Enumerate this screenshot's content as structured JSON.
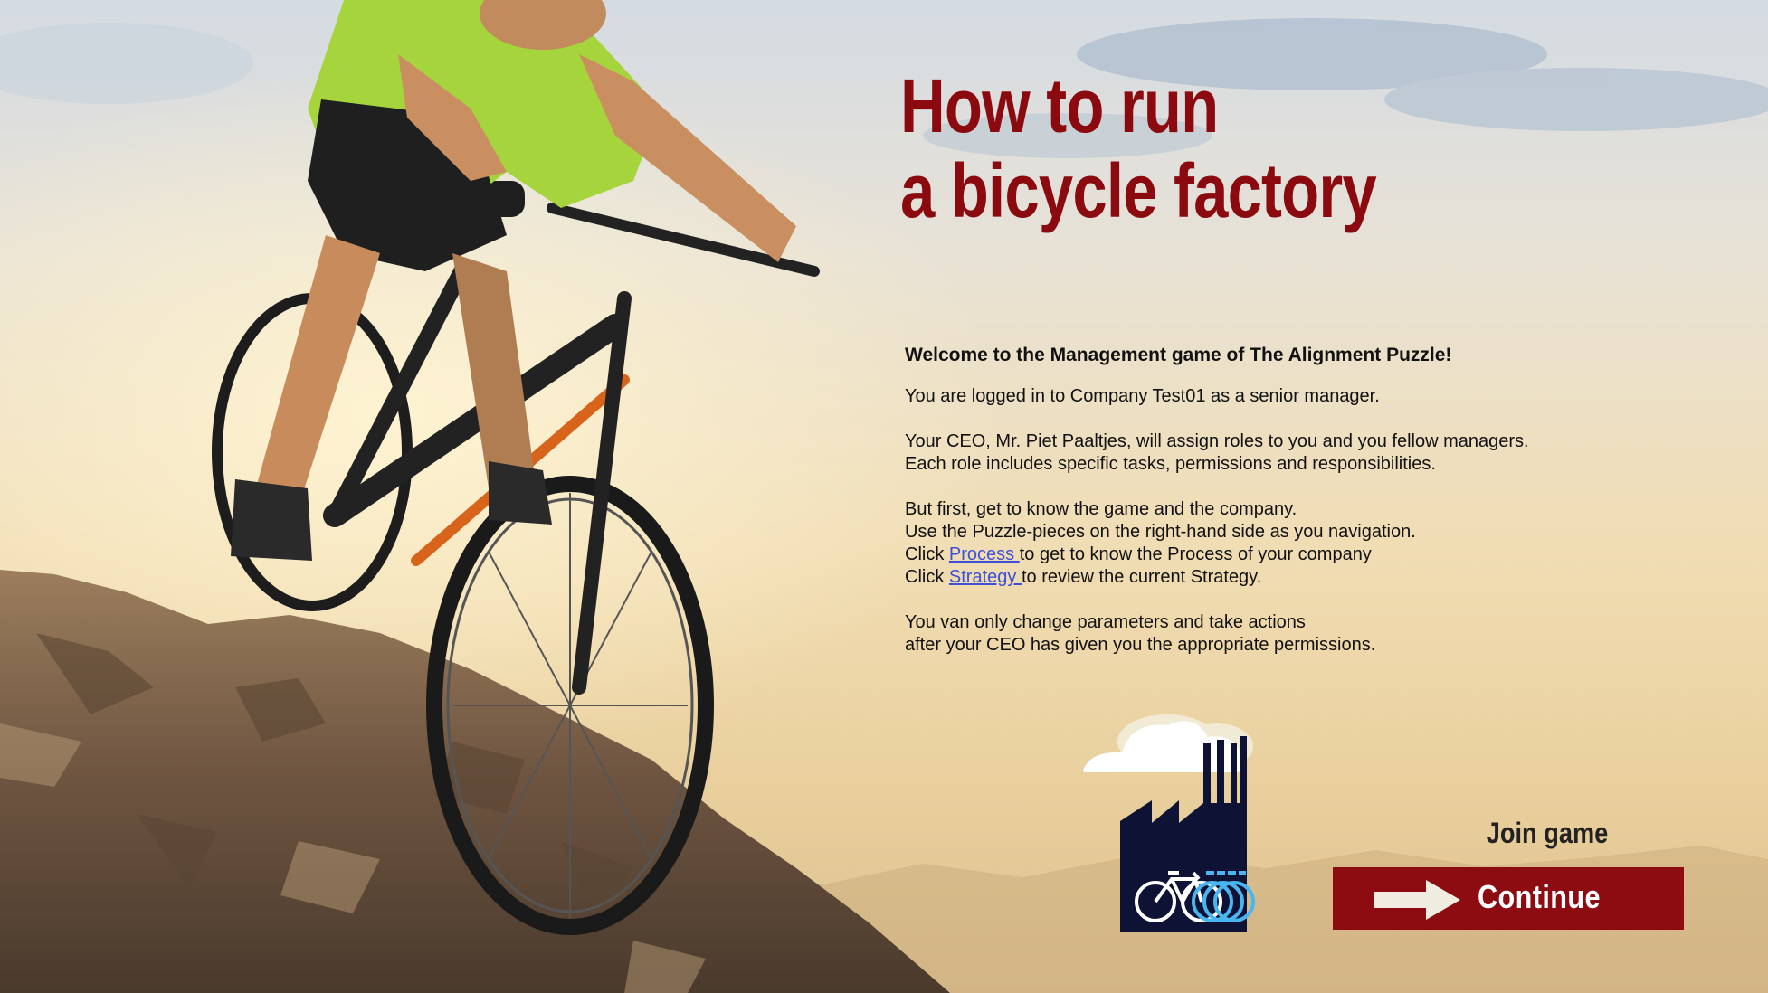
{
  "title": {
    "line1": "How to run",
    "line2": "a bicycle factory"
  },
  "intro": {
    "welcome": "Welcome to the Management game of The Alignment Puzzle!",
    "logged_in": "You are logged in to Company Test01 as a senior manager.",
    "roles_line1": "Your CEO, Mr. Piet Paaltjes, will assign roles to you and you fellow managers.",
    "roles_line2": "Each role includes specific tasks, permissions and responsibilities.",
    "first_line1": "But first, get to know the game and the company.",
    "first_line2": "Use the Puzzle-pieces on the right-hand side as you navigation.",
    "click_word": "Click",
    "process_link": "Process ",
    "process_rest": "to get to know the Process of your company",
    "strategy_link": "Strategy ",
    "strategy_rest": "to review the current Strategy.",
    "perm_line1": "You van only change parameters and take actions",
    "perm_line2": "after your CEO has given you the appropriate permissions."
  },
  "actions": {
    "join_label": "Join game",
    "continue_label": "Continue"
  },
  "colors": {
    "title": "#8a0a0f",
    "button": "#8c0c12",
    "link": "#3d50d6",
    "factory": "#0e1235",
    "bike_icon": "#49b6f0"
  },
  "icons": {
    "factory": "factory-icon",
    "bicycle": "bicycle-icon",
    "cloud": "cloud-icon",
    "arrow": "arrow-right-icon"
  }
}
